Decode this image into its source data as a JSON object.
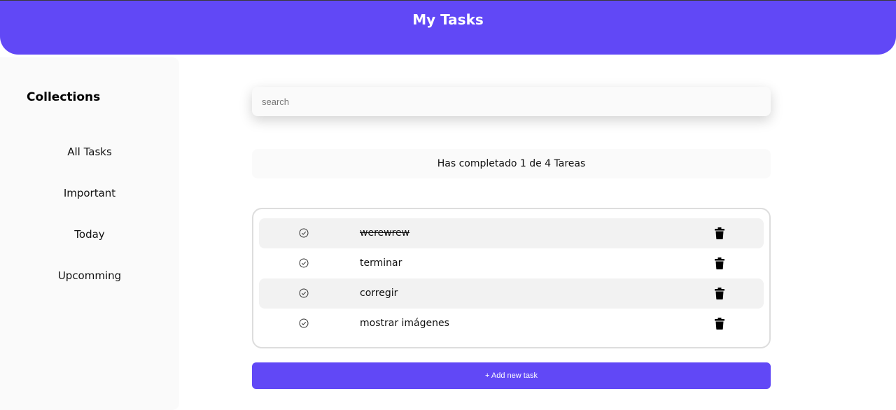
{
  "header": {
    "title": "My Tasks"
  },
  "sidebar": {
    "title": "Collections",
    "items": [
      {
        "label": "All Tasks"
      },
      {
        "label": "Important"
      },
      {
        "label": "Today"
      },
      {
        "label": "Upcomming"
      }
    ]
  },
  "search": {
    "placeholder": "search",
    "value": ""
  },
  "progress": {
    "text": "Has completado 1 de 4 Tareas",
    "completed": 1,
    "total": 4
  },
  "tasks": [
    {
      "text": "werewrew",
      "completed": true
    },
    {
      "text": "terminar",
      "completed": false
    },
    {
      "text": "corregir",
      "completed": false
    },
    {
      "text": "mostrar imágenes",
      "completed": false
    }
  ],
  "actions": {
    "add_label": "+ Add new task"
  },
  "colors": {
    "accent": "#6148f6",
    "panel": "#fafafa",
    "row_shade": "#f2f2f2"
  },
  "icons": {
    "check": "check-circle-icon",
    "delete": "trash-icon"
  }
}
